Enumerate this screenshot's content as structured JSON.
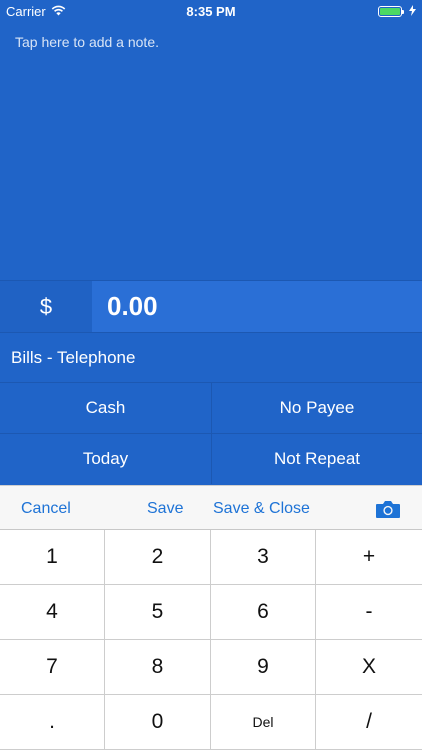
{
  "status_bar": {
    "carrier": "Carrier",
    "time": "8:35 PM",
    "battery_level": 1.0,
    "battery_color": "#4cd964"
  },
  "note": {
    "placeholder": "Tap here to add a note."
  },
  "amount": {
    "currency": "$",
    "value": "0.00"
  },
  "category": "Bills - Telephone",
  "details": {
    "method": "Cash",
    "payee": "No Payee",
    "date": "Today",
    "repeat": "Not Repeat"
  },
  "toolbar": {
    "cancel": "Cancel",
    "save": "Save",
    "save_close": "Save & Close",
    "camera_icon": "camera-icon"
  },
  "keypad": {
    "keys": [
      "1",
      "2",
      "3",
      "+",
      "4",
      "5",
      "6",
      "-",
      "7",
      "8",
      "9",
      "X",
      ".",
      "0",
      "Del",
      "/"
    ]
  },
  "colors": {
    "primary_blue": "#2064c8",
    "accent_blue": "#1e73d6"
  }
}
